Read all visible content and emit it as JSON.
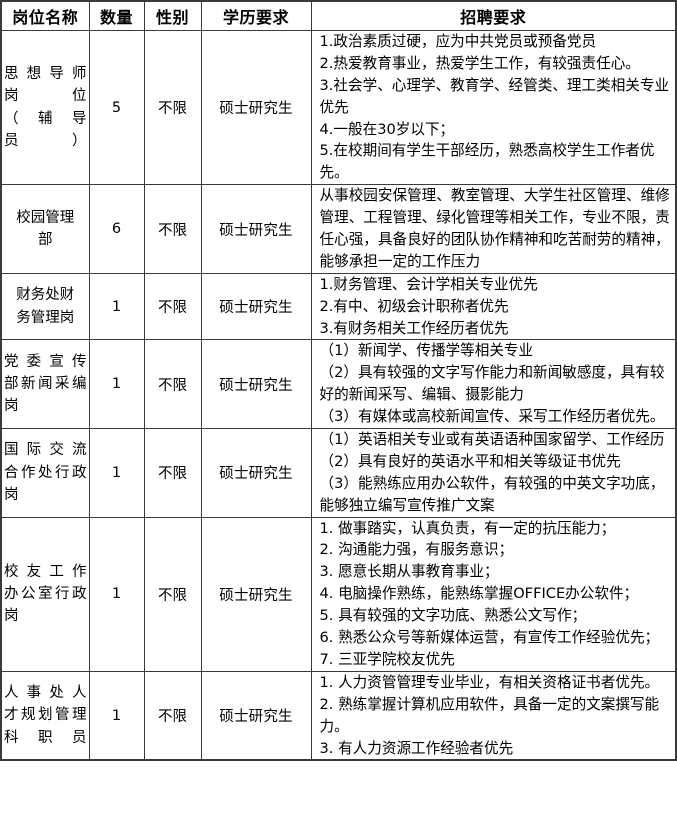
{
  "table": {
    "name": "recruitment-positions-table",
    "headers": [
      "岗位名称",
      "数量",
      "性别",
      "学历要求",
      "招聘要求"
    ],
    "rows": [
      {
        "post": "思想导师岗位（辅导员）",
        "post_lines": [
          "思想导师",
          "岗位",
          "（辅导",
          "员）"
        ],
        "number": "5",
        "gender": "不限",
        "education": "硕士研究生",
        "requirements": "1.政治素质过硬，应为中共党员或预备党员\n2.热爱教育事业，热爱学生工作，有较强责任心。\n3.社会学、心理学、教育学、经管类、理工类相关专业优先\n4.一般在30岁以下；\n5.在校期间有学生干部经历，熟悉高校学生工作者优先。",
        "requirement_lines": [
          "1.政治素质过硬，应为中共党员或预备党员",
          "2.热爱教育事业，热爱学生工作，有较强责任心。",
          "3.社会学、心理学、教育学、经管类、理工类相关专业优先",
          "4.一般在30岁以下；",
          "5.在校期间有学生干部经历，熟悉高校学生工作者优先。"
        ]
      },
      {
        "post": "校园管理部",
        "post_lines": [
          "校园管理",
          "部"
        ],
        "number": "6",
        "gender": "不限",
        "education": "硕士研究生",
        "requirements": "从事校园安保管理、教室管理、大学生社区管理、维修管理、工程管理、绿化管理等相关工作，专业不限，责任心强，具备良好的团队协作精神和吃苦耐劳的精神，能够承担一定的工作压力",
        "requirement_lines": [
          "从事校园安保管理、教室管理、大学生社区管理、维修管理、工程管理、绿化管理等相关工作，专业不限，责任心强，具备良好的团队协作精神和吃苦耐劳的精神，能够承担一定的工作压力"
        ]
      },
      {
        "post": "财务处财务管理岗",
        "post_lines": [
          "财务处财",
          "务管理岗"
        ],
        "number": "1",
        "gender": "不限",
        "education": "硕士研究生",
        "requirements": "1.财务管理、会计学相关专业优先\n2.有中、初级会计职称者优先\n3.有财务相关工作经历者优先",
        "requirement_lines": [
          "1.财务管理、会计学相关专业优先",
          "2.有中、初级会计职称者优先",
          "3.有财务相关工作经历者优先"
        ]
      },
      {
        "post": "党委宣传部新闻采编岗",
        "post_lines": [
          "党委宣传",
          "部新闻采编",
          "岗"
        ],
        "number": "1",
        "gender": "不限",
        "education": "硕士研究生",
        "requirements": "（1）新闻学、传播学等相关专业\n（2）具有较强的文字写作能力和新闻敏感度，具有较好的新闻采写、编辑、摄影能力\n（3）有媒体或高校新闻宣传、采写工作经历者优先。",
        "requirement_lines": [
          "（1）新闻学、传播学等相关专业",
          "（2）具有较强的文字写作能力和新闻敏感度，具有较好的新闻采写、编辑、摄影能力",
          "（3）有媒体或高校新闻宣传、采写工作经历者优先。"
        ]
      },
      {
        "post": "国际交流合作处行政岗",
        "post_lines": [
          "国际交流",
          "合作处行政",
          "岗"
        ],
        "number": "1",
        "gender": "不限",
        "education": "硕士研究生",
        "requirements": "（1）英语相关专业或有英语语种国家留学、工作经历\n（2）具有良好的英语水平和相关等级证书优先\n（3）能熟练应用办公软件，有较强的中英文字功底，能够独立编写宣传推广文案",
        "requirement_lines": [
          "（1）英语相关专业或有英语语种国家留学、工作经历",
          "（2）具有良好的英语水平和相关等级证书优先",
          "（3）能熟练应用办公软件，有较强的中英文字功底，能够独立编写宣传推广文案"
        ]
      },
      {
        "post": "校友工作办公室行政岗",
        "post_lines": [
          "校友工作",
          "办公室行政",
          "岗"
        ],
        "number": "1",
        "gender": "不限",
        "education": "硕士研究生",
        "requirements": "1. 做事踏实，认真负责，有一定的抗压能力；\n2. 沟通能力强，有服务意识；\n3. 愿意长期从事教育事业；\n4. 电脑操作熟练，能熟练掌握OFFICE办公软件；\n5. 具有较强的文字功底、熟悉公文写作；\n6. 熟悉公众号等新媒体运营，有宣传工作经验优先；\n7. 三亚学院校友优先",
        "requirement_lines": [
          "1. 做事踏实，认真负责，有一定的抗压能力；",
          "2. 沟通能力强，有服务意识；",
          "3. 愿意长期从事教育事业；",
          "4. 电脑操作熟练，能熟练掌握OFFICE办公软件；",
          "5. 具有较强的文字功底、熟悉公文写作；",
          "6. 熟悉公众号等新媒体运营，有宣传工作经验优先；",
          "7. 三亚学院校友优先"
        ]
      },
      {
        "post": "人事处人才规划管理科职员",
        "post_lines": [
          "人事处人",
          "才规划管理",
          "科职员"
        ],
        "number": "1",
        "gender": "不限",
        "education": "硕士研究生",
        "requirements": "1. 人力资管管理专业毕业，有相关资格证书者优先。\n2. 熟练掌握计算机应用软件，具备一定的文案撰写能力。\n3. 有人力资源工作经验者优先",
        "requirement_lines": [
          "1. 人力资管管理专业毕业，有相关资格证书者优先。",
          "2. 熟练掌握计算机应用软件，具备一定的文案撰写能力。",
          "3. 有人力资源工作经验者优先"
        ]
      }
    ]
  },
  "style": {
    "border_color": "#3a3a3a",
    "text_color": "#000000",
    "background": "#ffffff"
  }
}
